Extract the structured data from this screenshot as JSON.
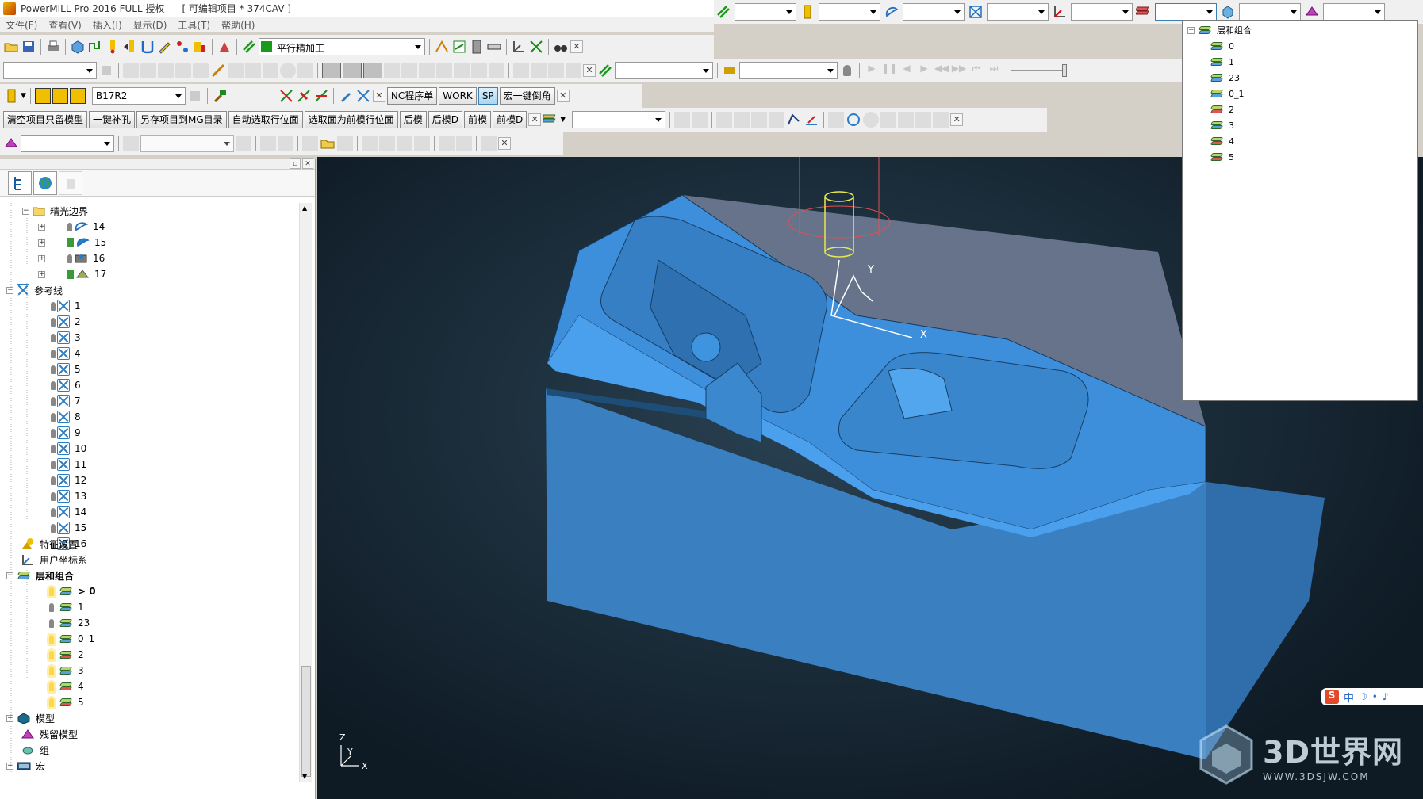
{
  "window": {
    "title": "PowerMILL Pro 2016 FULL 授权",
    "project": "[ 可编辑项目 * 374CAV ]"
  },
  "menu": [
    "文件(F)",
    "查看(V)",
    "插入(I)",
    "显示(D)",
    "工具(T)",
    "帮助(H)"
  ],
  "toolbar": {
    "toolpath_combo": "平行精加工",
    "tool_combo": "B17R2",
    "buttons1": [
      "NC程序单",
      "WORK",
      "SP",
      "宏一键倒角"
    ],
    "buttons2": [
      "清空项目只留模型",
      "一键补孔",
      "另存项目到MG目录",
      "自动选取行位面",
      "选取面为前模行位面",
      "后模",
      "后模D",
      "前模",
      "前模D"
    ]
  },
  "explorer": {
    "finish_boundary": {
      "label": "精光边界",
      "items": [
        "14",
        "15",
        "16",
        "17"
      ]
    },
    "reference_lines": {
      "label": "参考线",
      "items": [
        "1",
        "2",
        "3",
        "4",
        "5",
        "6",
        "7",
        "8",
        "9",
        "10",
        "11",
        "12",
        "13",
        "14",
        "15",
        "16"
      ]
    },
    "feature_settings": "特征设置",
    "user_cs": "用户坐标系",
    "layers": {
      "label": "层和组合",
      "items": [
        "> 0",
        "1",
        "23",
        "0_1",
        "2",
        "3",
        "4",
        "5"
      ]
    },
    "model": "模型",
    "stock_model": "残留模型",
    "group": "组",
    "macro": "宏"
  },
  "layer_dropdown": {
    "root": "层和组合",
    "items": [
      "0",
      "1",
      "23",
      "0_1",
      "2",
      "3",
      "4",
      "5"
    ]
  },
  "viewport": {
    "axis_x": "X",
    "axis_y": "Y",
    "axis_z": "Z",
    "model_color": "#3e8fd6"
  },
  "ime": {
    "text": "中"
  },
  "watermark": {
    "brand": "3D世界网",
    "url": "WWW.3DSJW.COM"
  }
}
